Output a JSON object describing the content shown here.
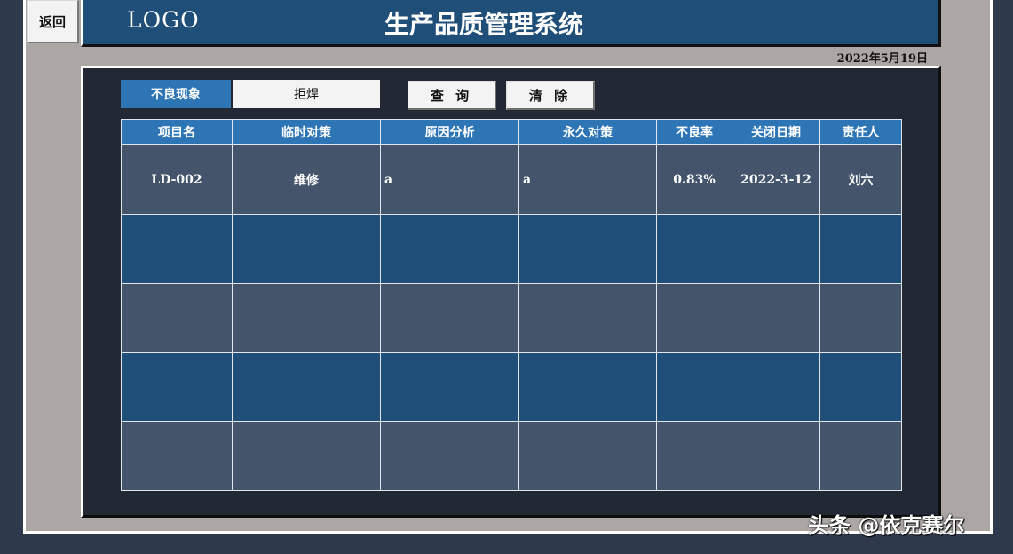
{
  "nav": {
    "back_label": "返回"
  },
  "header": {
    "logo": "LOGO",
    "title": "生产品质管理系统"
  },
  "date": "2022年5月19日",
  "filter": {
    "label": "不良现象",
    "value": "拒焊",
    "query_label": "查 询",
    "clear_label": "清 除"
  },
  "table": {
    "columns": [
      "项目名",
      "临时对策",
      "原因分析",
      "永久对策",
      "不良率",
      "关闭日期",
      "责任人"
    ],
    "rows": [
      [
        "LD-002",
        "维修",
        "a",
        "a",
        "0.83%",
        "2022-3-12",
        "刘六"
      ],
      [
        "",
        "",
        "",
        "",
        "",
        "",
        ""
      ],
      [
        "",
        "",
        "",
        "",
        "",
        "",
        ""
      ],
      [
        "",
        "",
        "",
        "",
        "",
        "",
        ""
      ],
      [
        "",
        "",
        "",
        "",
        "",
        "",
        ""
      ]
    ]
  },
  "watermark": "头条 @依克赛尔",
  "colors": {
    "header_bg": "#1f4e79",
    "accent": "#2e75b6",
    "row_odd": "#44546a",
    "row_even": "#1f4e79",
    "panel_bg": "#222834",
    "frame_bg": "#aca6a4"
  }
}
